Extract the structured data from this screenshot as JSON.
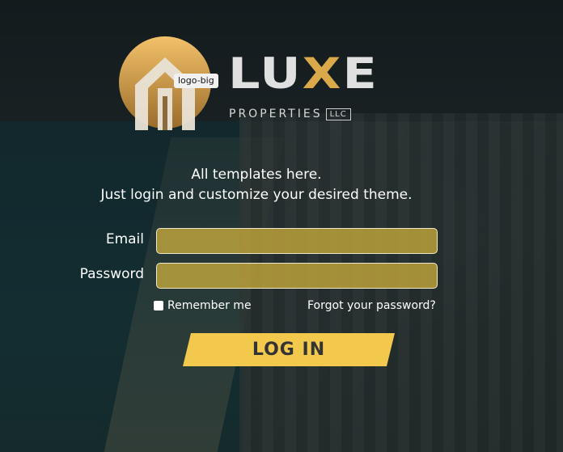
{
  "logo": {
    "tag": "logo-big",
    "word": "LU",
    "word_x": "X",
    "word_end": "E",
    "sub": "PROPERTIES",
    "llc": "LLC"
  },
  "tagline": {
    "line1": "All templates here.",
    "line2": "Just login and customize your desired theme."
  },
  "form": {
    "email_label": "Email",
    "email_value": "",
    "password_label": "Password",
    "password_value": "",
    "remember_label": "Remember me",
    "forgot_label": "Forgot your password?",
    "login_label": "LOG IN"
  },
  "colors": {
    "accent": "#f2c94c",
    "input_fill": "#c8aa3c",
    "logo_gold": "#d9a94a"
  }
}
